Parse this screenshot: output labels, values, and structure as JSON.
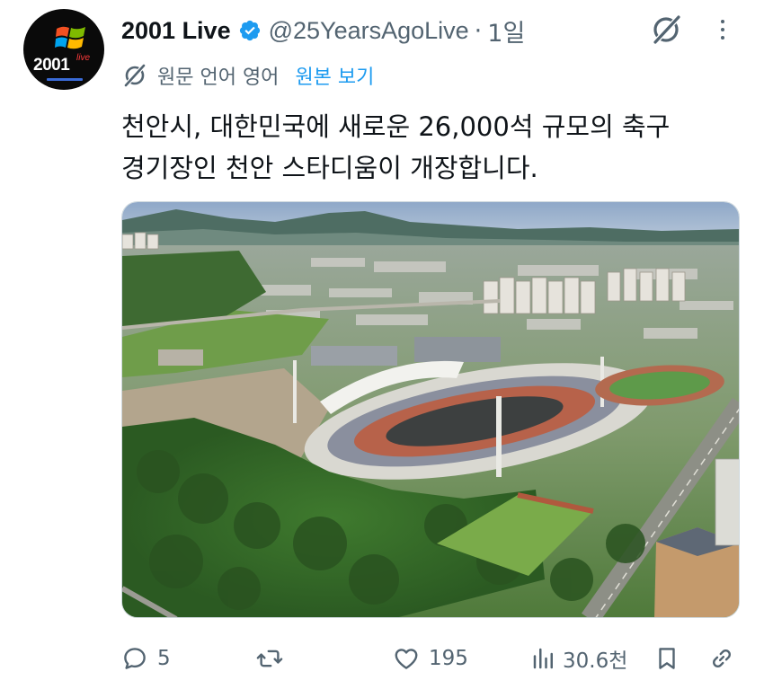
{
  "author": {
    "name": "2001 Live",
    "handle": "@25YearsAgoLive",
    "separator": "·",
    "time": "1일",
    "avatar_text": "2001",
    "avatar_sub": "live"
  },
  "translation": {
    "label": "원문 언어 영어",
    "show_original": "원본 보기"
  },
  "tweet": {
    "line1": "천안시, 대한민국에 새로운 26,000석 규모의 축구",
    "line2": "경기장인 천안 스타디움이 개장합니다."
  },
  "actions": {
    "replies": "5",
    "reposts": "",
    "likes": "195",
    "views": "30.6천"
  },
  "colors": {
    "verified": "#1d9bf0",
    "link": "#1d9bf0",
    "muted": "#536471"
  },
  "icons": [
    "verified-badge-icon",
    "grok-icon",
    "more-icon",
    "translate-icon",
    "reply-icon",
    "repost-icon",
    "like-icon",
    "views-icon",
    "bookmark-icon",
    "share-icon"
  ]
}
